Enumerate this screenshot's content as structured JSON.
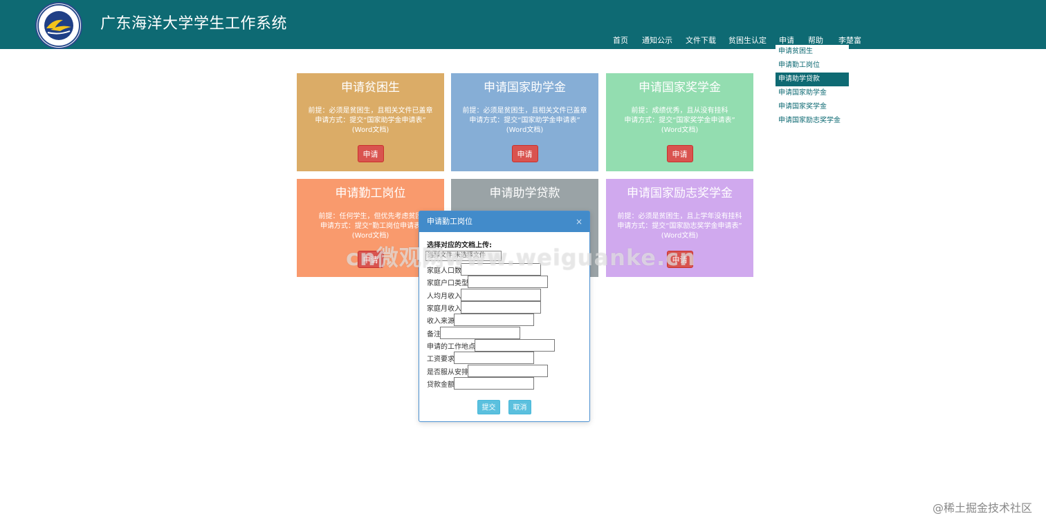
{
  "header": {
    "title": "广东海洋大学学生工作系统",
    "logo_icon": "university-seal-icon",
    "bg_color": "#0e6a73"
  },
  "nav": {
    "items": [
      "首页",
      "通知公示",
      "文件下载",
      "贫困生认定",
      "申请",
      "帮助",
      "李楚富"
    ]
  },
  "dropdown": {
    "items": [
      "申请贫困生",
      "申请勤工岗位",
      "申请助学贷款",
      "申请国家助学金",
      "申请国家奖学金",
      "申请国家励志奖学金"
    ],
    "active": "申请助学贷款"
  },
  "cards": [
    {
      "title": "申请贫困生",
      "lines": [
        "前提：必须是贫困生，且相关文件已盖章",
        "申请方式：提交“国家助学金申请表”",
        "(Word文档)"
      ],
      "button": "申请",
      "color": "#dbac67"
    },
    {
      "title": "申请国家助学金",
      "lines": [
        "前提：必须是贫困生，且相关文件已盖章",
        "申请方式：提交“国家助学金申请表”",
        "(Word文档)"
      ],
      "button": "申请",
      "color": "#86aed6"
    },
    {
      "title": "申请国家奖学金",
      "lines": [
        "前提：成绩优秀，且从没有挂科",
        "申请方式：提交“国家奖学金申请表”",
        "(Word文档)"
      ],
      "button": "申请",
      "color": "#93ddb0"
    },
    {
      "title": "申请勤工岗位",
      "lines": [
        "前提：任何学生，但优先考虑贫困",
        "申请方式：提交“勤工岗位申请表",
        "(Word文档)"
      ],
      "button": "申请",
      "color": "#f99a6d"
    },
    {
      "title": "申请助学贷款",
      "lines": [],
      "button": "",
      "color": "#9aa3a6"
    },
    {
      "title": "申请国家励志奖学金",
      "lines": [
        "前提：必须是贫困生，且上学年没有挂科",
        "申请方式：提交“国家励志奖学金申请表”",
        "(Word文档)"
      ],
      "button": "申请",
      "color": "#d0a9ee"
    }
  ],
  "modal": {
    "title": "申请勤工岗位",
    "close_icon": "close-icon",
    "subtitle": "选择对应的文档上传:",
    "upload_text": "选择文件  未选择文件",
    "fields": [
      "家庭人口数",
      "家庭户口类型",
      "人均月收入",
      "家庭月收入",
      "收入来源",
      "备注",
      "申请的工作地点",
      "工资要求",
      "是否服从安排",
      "贷款金额"
    ],
    "submit": "提交",
    "cancel": "取消"
  },
  "watermark": "cn微观网www.weiguanke.cn",
  "footer_credit": "@稀土掘金技术社区"
}
